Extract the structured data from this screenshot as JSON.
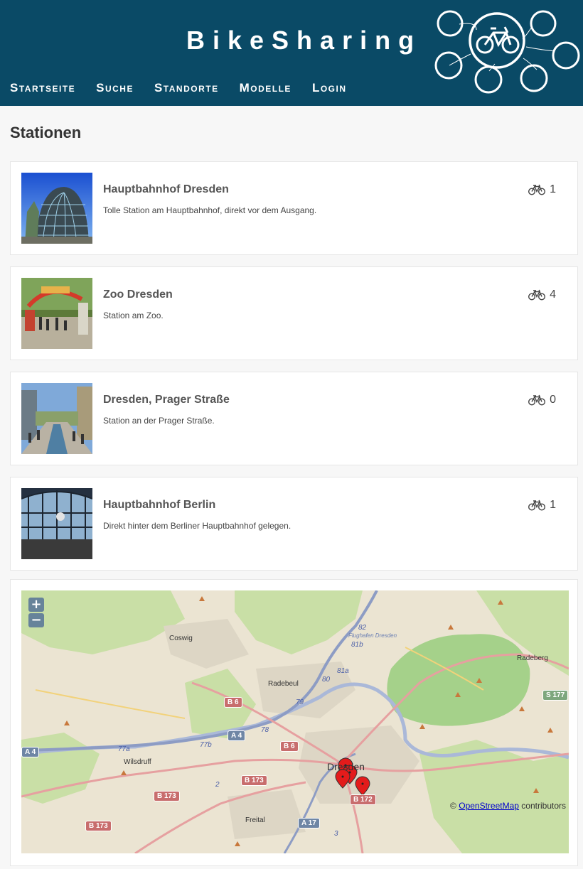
{
  "header": {
    "brand": "BikeSharing",
    "nav": [
      "Startseite",
      "Suche",
      "Standorte",
      "Modelle",
      "Login"
    ],
    "logo_icon": "bike-network-logo-icon",
    "background": "#0a4a66"
  },
  "page_title": "Stationen",
  "stations": [
    {
      "name": "Hauptbahnhof Dresden",
      "description": "Tolle Station am Hauptbahnhof, direkt vor dem Ausgang.",
      "bikes": "1",
      "icon": "bicycle-icon"
    },
    {
      "name": "Zoo Dresden",
      "description": "Station am Zoo.",
      "bikes": "4",
      "icon": "bicycle-icon"
    },
    {
      "name": "Dresden, Prager Straße",
      "description": "Station an der Prager Straße.",
      "bikes": "0",
      "icon": "bicycle-icon"
    },
    {
      "name": "Hauptbahnhof Berlin",
      "description": "Direkt hinter dem Berliner Hauptbahnhof gelegen.",
      "bikes": "1",
      "icon": "bicycle-icon"
    }
  ],
  "map": {
    "zoom_in": "+",
    "zoom_out": "−",
    "attribution_prefix": "©",
    "attribution_link": "OpenStreetMap",
    "attribution_suffix": "contributors",
    "labels": {
      "coswig": "Coswig",
      "radebeul": "Radebeul",
      "radeberg": "Radeberg",
      "wilsdruff": "Wilsdruff",
      "dresden": "Dresden",
      "freital": "Freital",
      "airport": "Flughafen Dresden"
    },
    "shields": {
      "b6a": "B 6",
      "b6b": "B 6",
      "a4a": "A 4",
      "a4b": "A 4",
      "b173a": "B 173",
      "b173b": "B 173",
      "b173c": "B 173",
      "b172": "B 172",
      "a17": "A 17",
      "s177": "S 177"
    },
    "exits": [
      "82",
      "81b",
      "81a",
      "80",
      "79",
      "78",
      "77a",
      "77b",
      "2",
      "3"
    ],
    "marker_color": "#e31b1b"
  }
}
